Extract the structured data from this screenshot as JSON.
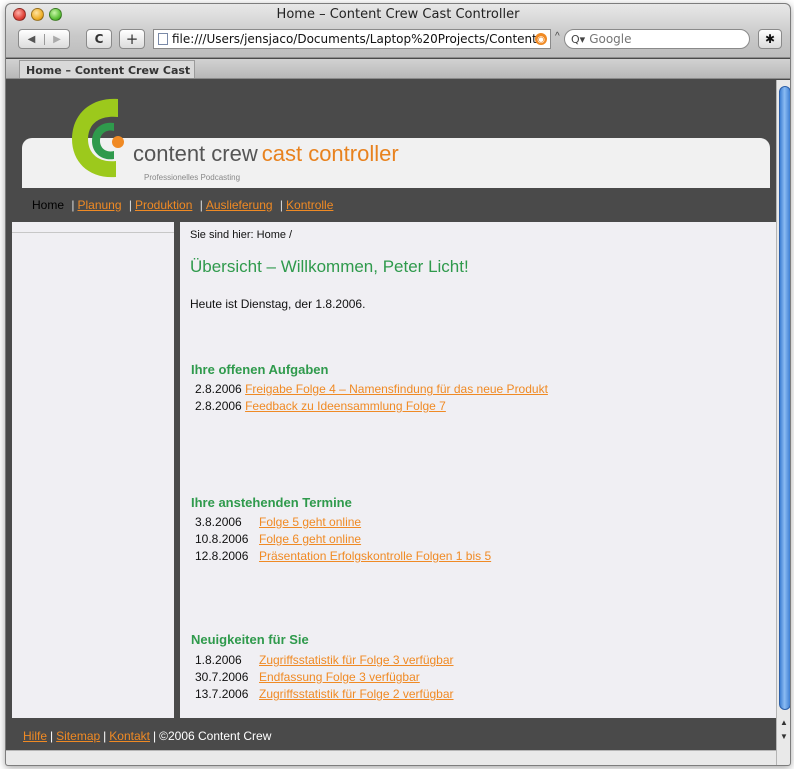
{
  "window": {
    "title": "Home – Content Crew Cast Controller",
    "url": "file:///Users/jensjaco/Documents/Laptop%20Projects/Content",
    "search_placeholder": "Google",
    "tab_label": "Home – Content Crew Cast ..."
  },
  "site": {
    "brand_main": "content crew",
    "brand_accent": "cast controller",
    "tagline": "Professionelles Podcasting",
    "nav": {
      "current": "Home",
      "items": [
        "Planung",
        "Produktion",
        "Auslieferung",
        "Kontrolle"
      ]
    },
    "breadcrumb": "Sie sind hier: Home /",
    "page_title": "Übersicht – Willkommen, Peter Licht!",
    "today": "Heute ist Dienstag, der 1.8.2006."
  },
  "sections": {
    "tasks": {
      "heading": "Ihre offenen Aufgaben",
      "items": [
        {
          "date": "2.8.2006",
          "text": "Freigabe Folge 4 – Namensfindung für das neue Produkt"
        },
        {
          "date": "2.8.2006",
          "text": "Feedback zu Ideensammlung Folge 7"
        }
      ]
    },
    "appointments": {
      "heading": "Ihre anstehenden Termine",
      "items": [
        {
          "date": "3.8.2006",
          "text": "Folge 5 geht online"
        },
        {
          "date": "10.8.2006",
          "text": "Folge 6 geht online"
        },
        {
          "date": "12.8.2006",
          "text": "Präsentation Erfolgskontrolle Folgen 1 bis 5"
        }
      ]
    },
    "news": {
      "heading": "Neuigkeiten für Sie",
      "items": [
        {
          "date": "1.8.2006",
          "text": "Zugriffsstatistik für Folge 3 verfügbar"
        },
        {
          "date": "30.7.2006",
          "text": "Endfassung Folge 3 verfügbar"
        },
        {
          "date": "13.7.2006",
          "text": "Zugriffsstatistik für Folge 2 verfügbar"
        }
      ]
    }
  },
  "footer": {
    "links": [
      "Hilfe",
      "Sitemap",
      "Kontakt"
    ],
    "copyright": "©2006 Content Crew"
  },
  "colors": {
    "green": "#2f9a4c",
    "orange": "#f08a24",
    "dark_gray": "#4a4a4a",
    "content_bg": "#f0eff3"
  }
}
